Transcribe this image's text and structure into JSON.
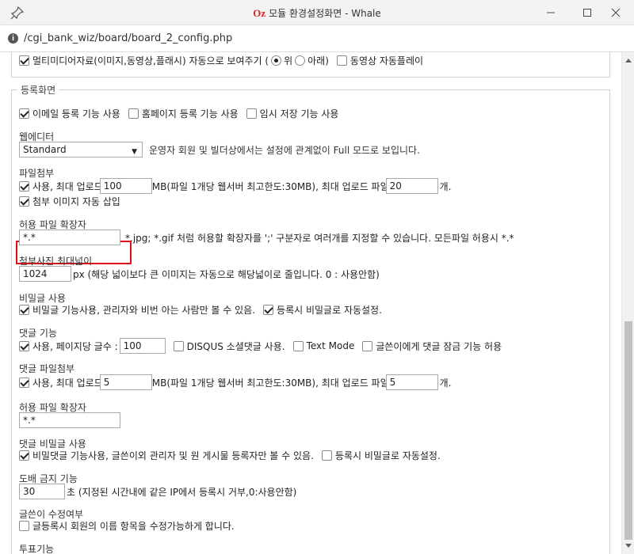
{
  "window": {
    "brand": "Oz",
    "title": "모듈 환경설정화면 - Whale",
    "url": "/cgi_bank_wiz/board/board_2_config.php"
  },
  "top_row": {
    "multimedia_label": "멀티미디어자료(이미지,동영상,플래시) 자동으로 보여주기 (",
    "opt_top": "위",
    "opt_bottom": "아래)",
    "autoplay_label": "동영상 자동플레이"
  },
  "section": {
    "legend": "등록화면"
  },
  "features": {
    "email": "이메일 등록 기능 사용",
    "homepage": "홈페이지 등록 기능 사용",
    "tempsave": "임시 저장 기능 사용"
  },
  "editor": {
    "title": "웹에디터",
    "select_value": "Standard",
    "note": "운영자 회원 및 빌더상에서는 설정에 관계없이 Full 모드로 보입니다."
  },
  "attach": {
    "title": "파일첨부",
    "use_label": "사용, 최대 업로드",
    "size_value": "100",
    "size_note": "MB(파일 1개당 웹서버 최고한도:30MB), 최대 업로드 파일",
    "count_value": "20",
    "count_suffix": "개.",
    "auto_insert_label": "첨부 이미지 자동 삽입"
  },
  "allowed_ext": {
    "title": "허용 파일 확장자",
    "value": "*.*",
    "note": "*.jpg; *.gif 처럼 허용할 확장자를 ';' 구분자로 여러개를 지정할 수 있습니다. 모든파일 허용시 *.*"
  },
  "max_width": {
    "title": "첨부사진 최대넓이",
    "value": "1024",
    "note": "px (해당 넓이보다 큰 이미지는 자동으로 해당넓이로 줄입니다. 0 : 사용안함)"
  },
  "secret": {
    "title": "비밀글 사용",
    "use_label": "비밀글 기능사용, 관리자와 비번 아는 사람만 볼 수 있음.",
    "auto_label": "등록시 비밀글로 자동설정."
  },
  "comment": {
    "title": "댓글 기능",
    "use_label": "사용, 페이지당 글수 :",
    "per_page": "100",
    "disqus": "DISQUS 소셜댓글 사용.",
    "textmode": "Text Mode",
    "lock": "글쓴이에게 댓글 잠금 기능 허용"
  },
  "comment_attach": {
    "title": "댓글 파일첨부",
    "use_label": "사용, 최대 업로드",
    "size_value": "5",
    "size_note": "MB(파일 1개당 웹서버 최고한도:30MB), 최대 업로드 파일",
    "count_value": "5",
    "count_suffix": "개."
  },
  "comment_ext": {
    "title": "허용 파일 확장자",
    "value": "*.*"
  },
  "comment_secret": {
    "title": "댓글 비밀글 사용",
    "use_label": "비밀댓글 기능사용, 글쓴이외 관리자 및 원 게시물 등록자만 볼 수 있음.",
    "auto_label": "등록시 비밀글로 자동설정."
  },
  "flood": {
    "title": "도배 금지 기능",
    "value": "30",
    "note": "초 (지정된 시간내에 같은 IP에서 등록시 거부,0:사용안함)"
  },
  "author_edit": {
    "title": "글쓴이 수정여부",
    "label": "글등록시 회원의 이름 항목을 수정가능하게 합니다."
  },
  "vote": {
    "title": "투표기능"
  }
}
